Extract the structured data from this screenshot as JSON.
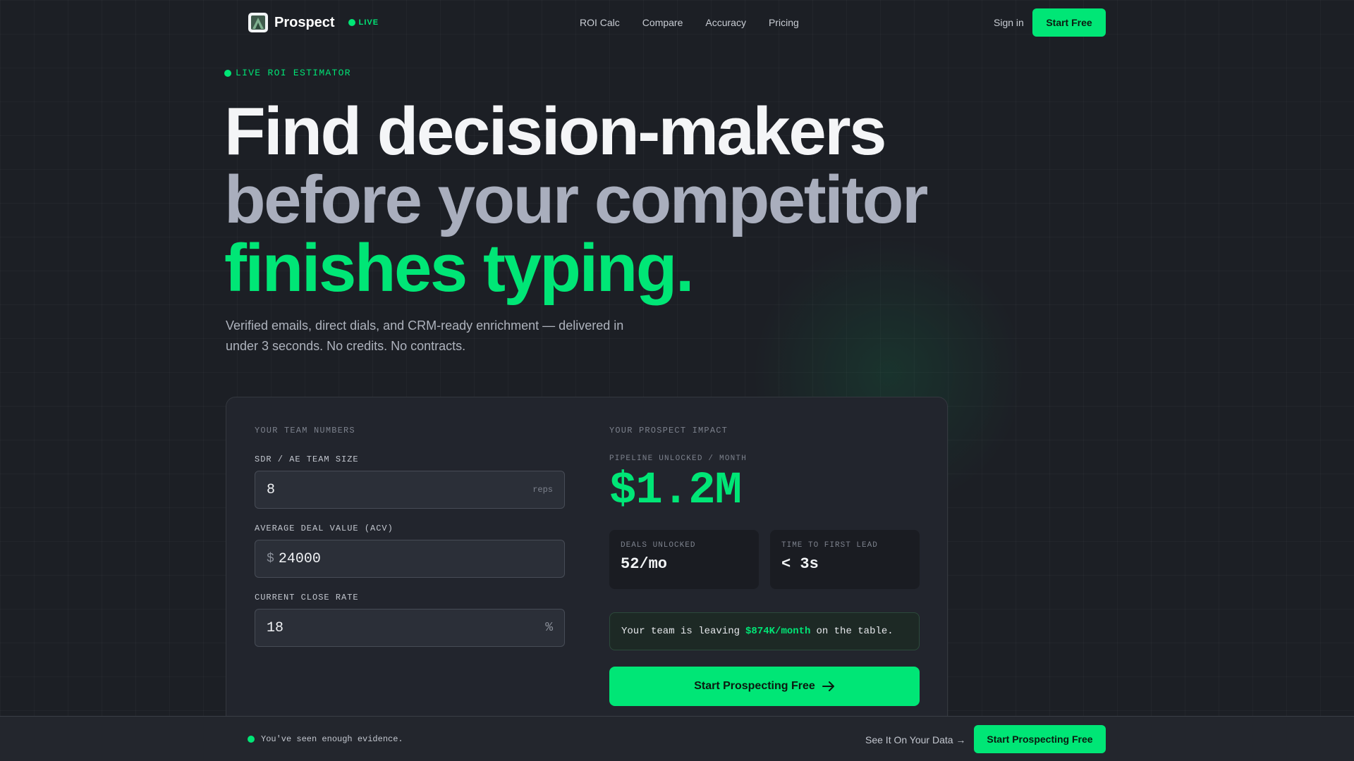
{
  "nav": {
    "brand": "Prospect",
    "live_badge": "LIVE",
    "links": [
      "ROI Calc",
      "Compare",
      "Accuracy",
      "Pricing"
    ],
    "sign_in": "Sign in",
    "cta": "Start Free"
  },
  "hero": {
    "eyebrow": "LIVE ROI ESTIMATOR",
    "line1": "Find decision-makers",
    "line2": "before your competitor",
    "line3": "finishes typing.",
    "subtitle": "Verified emails, direct dials, and CRM-ready enrichment — delivered in under 3 seconds. No credits. No contracts."
  },
  "calculator": {
    "inputs_title": "YOUR TEAM NUMBERS",
    "team_size": {
      "label": "SDR / AE TEAM SIZE",
      "value": "8",
      "suffix": "reps"
    },
    "deal_value": {
      "label": "AVERAGE DEAL VALUE (ACV)",
      "prefix": "$",
      "value": "24000"
    },
    "close_rate": {
      "label": "CURRENT CLOSE RATE",
      "value": "18",
      "suffix": "%"
    },
    "impact_title": "YOUR PROSPECT IMPACT",
    "pipeline_label": "PIPELINE UNLOCKED / MONTH",
    "pipeline_value": "$1.2M",
    "stats": [
      {
        "label": "DEALS UNLOCKED",
        "value": "52/mo"
      },
      {
        "label": "TIME TO FIRST LEAD",
        "value": "< 3s"
      }
    ],
    "leaving": {
      "prefix": "Your team is leaving",
      "amount": "$874K/month",
      "suffix": "on the table."
    },
    "cta": "Start Prospecting Free"
  },
  "sticky_bar": {
    "message": "You've seen enough evidence.",
    "link": "See It On Your Data →",
    "cta": "Start Prospecting Free"
  },
  "colors": {
    "accent": "#00e676",
    "background": "#1c1f25",
    "card": "#22252d"
  },
  "icons": [
    "prospect-logo-icon",
    "live-dot-icon",
    "arrow-right-icon"
  ]
}
